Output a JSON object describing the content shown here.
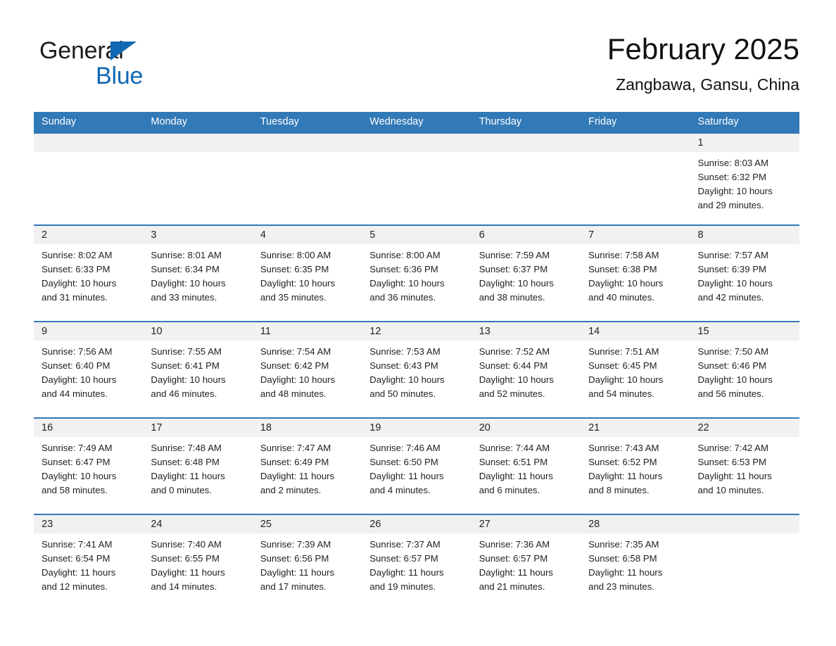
{
  "brand": {
    "line1": "General",
    "line2": "Blue",
    "triangle_color": "#1068b3"
  },
  "header": {
    "title": "February 2025",
    "location": "Zangbawa, Gansu, China"
  },
  "theme": {
    "header_blue": "#3279b7",
    "daynum_gray": "#f1f1f1",
    "text": "#1f1f1f"
  },
  "calendar": {
    "weekdays": [
      "Sunday",
      "Monday",
      "Tuesday",
      "Wednesday",
      "Thursday",
      "Friday",
      "Saturday"
    ],
    "weeks": [
      [
        {
          "day": "",
          "sunrise": "",
          "sunset": "",
          "daylight1": "",
          "daylight2": "",
          "empty": true
        },
        {
          "day": "",
          "sunrise": "",
          "sunset": "",
          "daylight1": "",
          "daylight2": "",
          "empty": true
        },
        {
          "day": "",
          "sunrise": "",
          "sunset": "",
          "daylight1": "",
          "daylight2": "",
          "empty": true
        },
        {
          "day": "",
          "sunrise": "",
          "sunset": "",
          "daylight1": "",
          "daylight2": "",
          "empty": true
        },
        {
          "day": "",
          "sunrise": "",
          "sunset": "",
          "daylight1": "",
          "daylight2": "",
          "empty": true
        },
        {
          "day": "",
          "sunrise": "",
          "sunset": "",
          "daylight1": "",
          "daylight2": "",
          "empty": true
        },
        {
          "day": "1",
          "sunrise": "Sunrise: 8:03 AM",
          "sunset": "Sunset: 6:32 PM",
          "daylight1": "Daylight: 10 hours",
          "daylight2": "and 29 minutes.",
          "empty": false
        }
      ],
      [
        {
          "day": "2",
          "sunrise": "Sunrise: 8:02 AM",
          "sunset": "Sunset: 6:33 PM",
          "daylight1": "Daylight: 10 hours",
          "daylight2": "and 31 minutes.",
          "empty": false
        },
        {
          "day": "3",
          "sunrise": "Sunrise: 8:01 AM",
          "sunset": "Sunset: 6:34 PM",
          "daylight1": "Daylight: 10 hours",
          "daylight2": "and 33 minutes.",
          "empty": false
        },
        {
          "day": "4",
          "sunrise": "Sunrise: 8:00 AM",
          "sunset": "Sunset: 6:35 PM",
          "daylight1": "Daylight: 10 hours",
          "daylight2": "and 35 minutes.",
          "empty": false
        },
        {
          "day": "5",
          "sunrise": "Sunrise: 8:00 AM",
          "sunset": "Sunset: 6:36 PM",
          "daylight1": "Daylight: 10 hours",
          "daylight2": "and 36 minutes.",
          "empty": false
        },
        {
          "day": "6",
          "sunrise": "Sunrise: 7:59 AM",
          "sunset": "Sunset: 6:37 PM",
          "daylight1": "Daylight: 10 hours",
          "daylight2": "and 38 minutes.",
          "empty": false
        },
        {
          "day": "7",
          "sunrise": "Sunrise: 7:58 AM",
          "sunset": "Sunset: 6:38 PM",
          "daylight1": "Daylight: 10 hours",
          "daylight2": "and 40 minutes.",
          "empty": false
        },
        {
          "day": "8",
          "sunrise": "Sunrise: 7:57 AM",
          "sunset": "Sunset: 6:39 PM",
          "daylight1": "Daylight: 10 hours",
          "daylight2": "and 42 minutes.",
          "empty": false
        }
      ],
      [
        {
          "day": "9",
          "sunrise": "Sunrise: 7:56 AM",
          "sunset": "Sunset: 6:40 PM",
          "daylight1": "Daylight: 10 hours",
          "daylight2": "and 44 minutes.",
          "empty": false
        },
        {
          "day": "10",
          "sunrise": "Sunrise: 7:55 AM",
          "sunset": "Sunset: 6:41 PM",
          "daylight1": "Daylight: 10 hours",
          "daylight2": "and 46 minutes.",
          "empty": false
        },
        {
          "day": "11",
          "sunrise": "Sunrise: 7:54 AM",
          "sunset": "Sunset: 6:42 PM",
          "daylight1": "Daylight: 10 hours",
          "daylight2": "and 48 minutes.",
          "empty": false
        },
        {
          "day": "12",
          "sunrise": "Sunrise: 7:53 AM",
          "sunset": "Sunset: 6:43 PM",
          "daylight1": "Daylight: 10 hours",
          "daylight2": "and 50 minutes.",
          "empty": false
        },
        {
          "day": "13",
          "sunrise": "Sunrise: 7:52 AM",
          "sunset": "Sunset: 6:44 PM",
          "daylight1": "Daylight: 10 hours",
          "daylight2": "and 52 minutes.",
          "empty": false
        },
        {
          "day": "14",
          "sunrise": "Sunrise: 7:51 AM",
          "sunset": "Sunset: 6:45 PM",
          "daylight1": "Daylight: 10 hours",
          "daylight2": "and 54 minutes.",
          "empty": false
        },
        {
          "day": "15",
          "sunrise": "Sunrise: 7:50 AM",
          "sunset": "Sunset: 6:46 PM",
          "daylight1": "Daylight: 10 hours",
          "daylight2": "and 56 minutes.",
          "empty": false
        }
      ],
      [
        {
          "day": "16",
          "sunrise": "Sunrise: 7:49 AM",
          "sunset": "Sunset: 6:47 PM",
          "daylight1": "Daylight: 10 hours",
          "daylight2": "and 58 minutes.",
          "empty": false
        },
        {
          "day": "17",
          "sunrise": "Sunrise: 7:48 AM",
          "sunset": "Sunset: 6:48 PM",
          "daylight1": "Daylight: 11 hours",
          "daylight2": "and 0 minutes.",
          "empty": false
        },
        {
          "day": "18",
          "sunrise": "Sunrise: 7:47 AM",
          "sunset": "Sunset: 6:49 PM",
          "daylight1": "Daylight: 11 hours",
          "daylight2": "and 2 minutes.",
          "empty": false
        },
        {
          "day": "19",
          "sunrise": "Sunrise: 7:46 AM",
          "sunset": "Sunset: 6:50 PM",
          "daylight1": "Daylight: 11 hours",
          "daylight2": "and 4 minutes.",
          "empty": false
        },
        {
          "day": "20",
          "sunrise": "Sunrise: 7:44 AM",
          "sunset": "Sunset: 6:51 PM",
          "daylight1": "Daylight: 11 hours",
          "daylight2": "and 6 minutes.",
          "empty": false
        },
        {
          "day": "21",
          "sunrise": "Sunrise: 7:43 AM",
          "sunset": "Sunset: 6:52 PM",
          "daylight1": "Daylight: 11 hours",
          "daylight2": "and 8 minutes.",
          "empty": false
        },
        {
          "day": "22",
          "sunrise": "Sunrise: 7:42 AM",
          "sunset": "Sunset: 6:53 PM",
          "daylight1": "Daylight: 11 hours",
          "daylight2": "and 10 minutes.",
          "empty": false
        }
      ],
      [
        {
          "day": "23",
          "sunrise": "Sunrise: 7:41 AM",
          "sunset": "Sunset: 6:54 PM",
          "daylight1": "Daylight: 11 hours",
          "daylight2": "and 12 minutes.",
          "empty": false
        },
        {
          "day": "24",
          "sunrise": "Sunrise: 7:40 AM",
          "sunset": "Sunset: 6:55 PM",
          "daylight1": "Daylight: 11 hours",
          "daylight2": "and 14 minutes.",
          "empty": false
        },
        {
          "day": "25",
          "sunrise": "Sunrise: 7:39 AM",
          "sunset": "Sunset: 6:56 PM",
          "daylight1": "Daylight: 11 hours",
          "daylight2": "and 17 minutes.",
          "empty": false
        },
        {
          "day": "26",
          "sunrise": "Sunrise: 7:37 AM",
          "sunset": "Sunset: 6:57 PM",
          "daylight1": "Daylight: 11 hours",
          "daylight2": "and 19 minutes.",
          "empty": false
        },
        {
          "day": "27",
          "sunrise": "Sunrise: 7:36 AM",
          "sunset": "Sunset: 6:57 PM",
          "daylight1": "Daylight: 11 hours",
          "daylight2": "and 21 minutes.",
          "empty": false
        },
        {
          "day": "28",
          "sunrise": "Sunrise: 7:35 AM",
          "sunset": "Sunset: 6:58 PM",
          "daylight1": "Daylight: 11 hours",
          "daylight2": "and 23 minutes.",
          "empty": false
        },
        {
          "day": "",
          "sunrise": "",
          "sunset": "",
          "daylight1": "",
          "daylight2": "",
          "empty": true
        }
      ]
    ]
  }
}
